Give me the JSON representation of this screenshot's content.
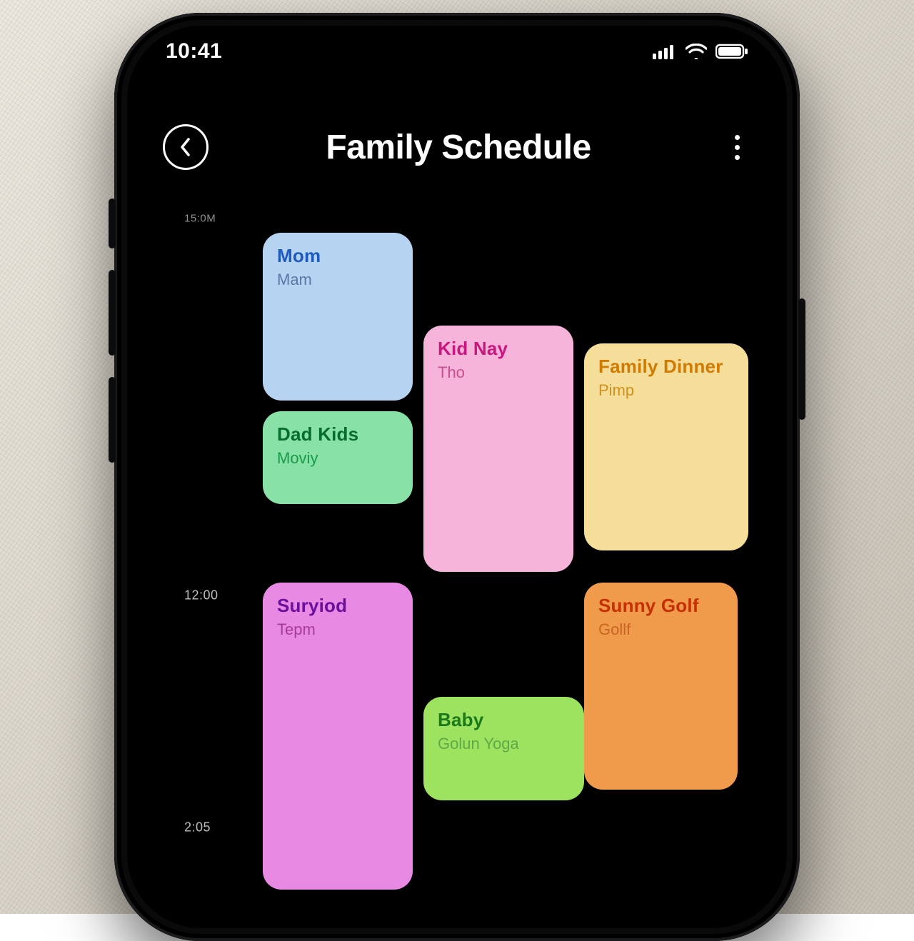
{
  "status": {
    "time": "10:41"
  },
  "header": {
    "title": "Family Schedule"
  },
  "timeline": {
    "labels": {
      "t0": "15:0M",
      "t1": "12:00",
      "t2": "2:05"
    }
  },
  "events": {
    "mom": {
      "title": "Mom",
      "sub": "Mam"
    },
    "kid": {
      "title": "Kid Nay",
      "sub": "Tho"
    },
    "fam": {
      "title": "Family Dinner",
      "sub": "Pimp"
    },
    "dad": {
      "title": "Dad Kids",
      "sub": "Moviy"
    },
    "sur": {
      "title": "Suryiod",
      "sub": "Tepm"
    },
    "sunny": {
      "title": "Sunny Golf",
      "sub": "Gollf"
    },
    "baby": {
      "title": "Baby",
      "sub": "Golun Yoga"
    }
  }
}
